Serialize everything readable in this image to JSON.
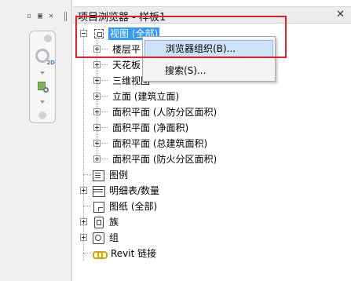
{
  "left_strip": {
    "window_buttons": [
      "▫",
      "▣",
      "✕"
    ]
  },
  "nav_bar": {
    "wheel_tag": "2D"
  },
  "browser": {
    "title": "项目浏览器 - 样板1",
    "close_glyph": "✕",
    "tree": {
      "views": {
        "label": "视图 (全部)"
      },
      "view_children": [
        {
          "label": "楼层平"
        },
        {
          "label": "天花板"
        },
        {
          "label": "三维视图"
        },
        {
          "label": "立面 (建筑立面)"
        },
        {
          "label": "面积平面 (人防分区面积)"
        },
        {
          "label": "面积平面 (净面积)"
        },
        {
          "label": "面积平面 (总建筑面积)"
        },
        {
          "label": "面积平面 (防火分区面积)"
        }
      ],
      "legend": {
        "label": "图例"
      },
      "schedules": {
        "label": "明细表/数量"
      },
      "sheets": {
        "label": "图纸 (全部)"
      },
      "families": {
        "label": "族"
      },
      "groups": {
        "label": "组"
      },
      "links": {
        "label": "Revit 链接"
      }
    }
  },
  "context_menu": {
    "items": [
      {
        "label": "浏览器组织(B)..."
      },
      {
        "label": "搜索(S)..."
      }
    ]
  },
  "colors": {
    "selection": "#3399ff",
    "highlight_box": "#e0202a",
    "menu_hover": "#cfe3f7"
  }
}
